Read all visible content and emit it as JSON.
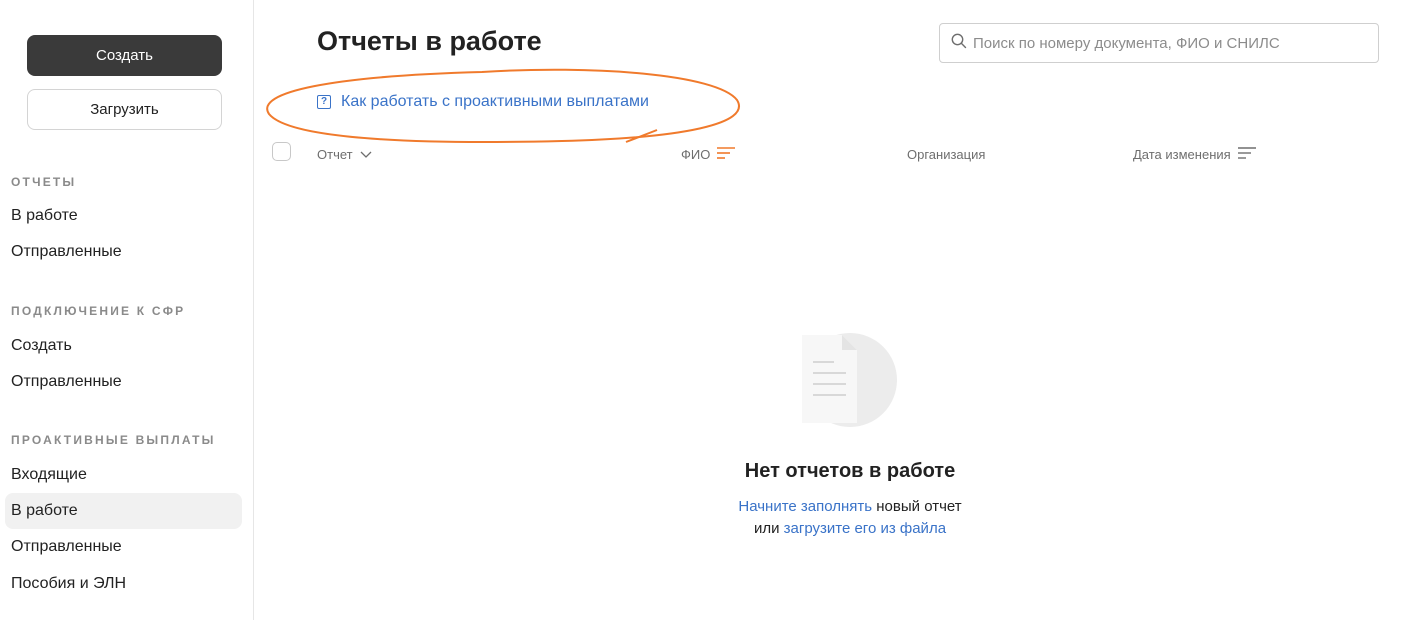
{
  "sidebar": {
    "create_label": "Создать",
    "upload_label": "Загрузить",
    "sections": [
      {
        "title": "ОТЧЕТЫ",
        "items": [
          "В работе",
          "Отправленные"
        ]
      },
      {
        "title": "ПОДКЛЮЧЕНИЕ К СФР",
        "items": [
          "Создать",
          "Отправленные"
        ]
      },
      {
        "title": "ПРОАКТИВНЫЕ ВЫПЛАТЫ",
        "items": [
          "Входящие",
          "В работе",
          "Отправленные",
          "Пособия и ЭЛН"
        ]
      }
    ],
    "active_item": "В работе (Проактивные выплаты)"
  },
  "header": {
    "title": "Отчеты в работе",
    "search_placeholder": "Поиск по номеру документа, ФИО и СНИЛС"
  },
  "help_link": "Как работать с проактивными выплатами",
  "table": {
    "columns": [
      "Отчет",
      "ФИО",
      "Организация",
      "Дата изменения"
    ]
  },
  "empty_state": {
    "title": "Нет отчетов в работе",
    "line1_link": "Начните заполнять",
    "line1_text": " новый отчет",
    "line2_text": "или ",
    "line2_link": "загрузите его из файла"
  },
  "colors": {
    "accent_link": "#3a73c8",
    "annotation": "#f07a2c",
    "primary_button": "#3a3a3a"
  },
  "icons": [
    "search-icon",
    "help-icon",
    "chevron-down-icon",
    "sort-icon",
    "document-icon"
  ]
}
